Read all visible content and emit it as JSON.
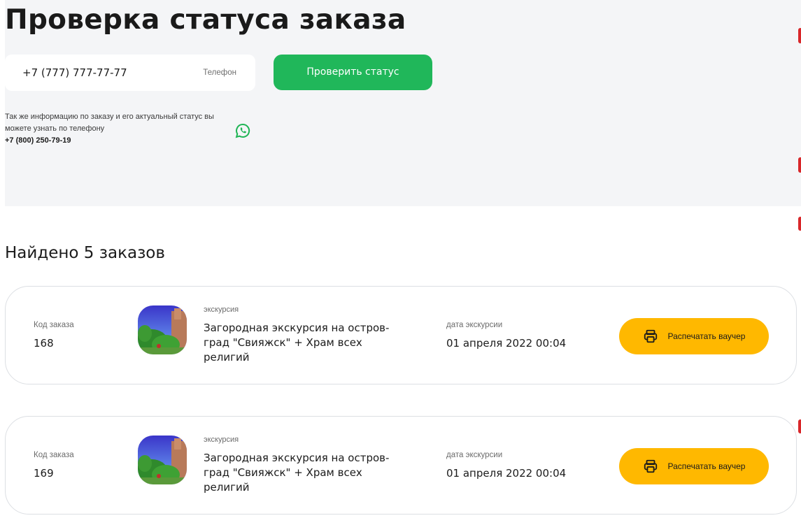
{
  "header": {
    "title": "Проверка статуса заказа"
  },
  "search": {
    "phone_value": "+7 (777) 777-77-77",
    "phone_label": "Телефон",
    "check_button_label": "Проверить статус"
  },
  "info": {
    "text": "Так же информацию по заказу и его актуальный статус вы можете узнать по телефону",
    "phone": "+7 (800) 250-79-19",
    "whatsapp_icon": "whatsapp-icon"
  },
  "results": {
    "title": "Найдено 5 заказов",
    "orders": [
      {
        "code_label": "Код заказа",
        "code": "168",
        "type": "экскурсия",
        "title": "Загородная экскурсия на остров-град \"Свияжск\" + Храм всех религий",
        "date_label": "дата экскурсии",
        "date": "01 апреля 2022 00:04",
        "print_label": "Распечатать ваучер"
      },
      {
        "code_label": "Код заказа",
        "code": "169",
        "type": "экскурсия",
        "title": "Загородная экскурсия на остров-град \"Свияжск\" + Храм всех религий",
        "date_label": "дата экскурсии",
        "date": "01 апреля 2022 00:04",
        "print_label": "Распечатать ваучер"
      }
    ]
  },
  "colors": {
    "accent_green": "#20b75a",
    "print_button": "#ffb800",
    "panel_bg": "#f4f5f7"
  }
}
